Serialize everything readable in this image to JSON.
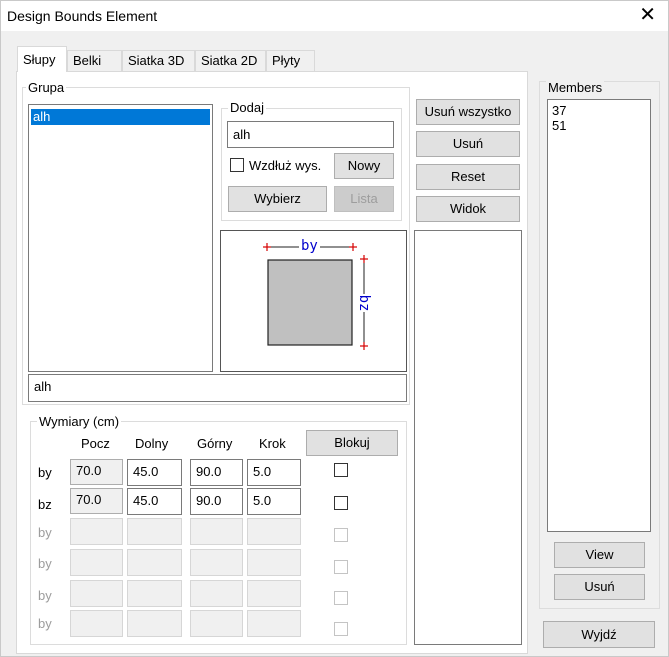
{
  "window": {
    "title": "Design Bounds Element"
  },
  "tabs": [
    {
      "label": "Słupy",
      "active": true
    },
    {
      "label": "Belki"
    },
    {
      "label": "Siatka 3D"
    },
    {
      "label": "Siatka 2D"
    },
    {
      "label": "Płyty"
    }
  ],
  "grupa": {
    "label": "Grupa",
    "items": [
      "alh"
    ],
    "name_value": "alh"
  },
  "dodaj": {
    "label": "Dodaj",
    "input_value": "alh",
    "checkbox_label": "Wzdłuż wys.",
    "checkbox_checked": false,
    "nowy_label": "Nowy",
    "wybierz_label": "Wybierz",
    "lista_label": "Lista"
  },
  "preview": {
    "by_label": "by",
    "bz_label": "bz"
  },
  "actions": {
    "usun_wszystko": "Usuń wszystko",
    "usun": "Usuń",
    "reset": "Reset",
    "widok": "Widok"
  },
  "wymiary": {
    "label": "Wymiary (cm)",
    "headers": [
      "Pocz",
      "Dolny",
      "Górny",
      "Krok"
    ],
    "blokuj_label": "Blokuj",
    "rows": [
      {
        "label": "by",
        "pocz": "70.0",
        "dolny": "45.0",
        "gorny": "90.0",
        "krok": "5.0",
        "enabled": true
      },
      {
        "label": "bz",
        "pocz": "70.0",
        "dolny": "45.0",
        "gorny": "90.0",
        "krok": "5.0",
        "enabled": true
      },
      {
        "label": "by",
        "enabled": false
      },
      {
        "label": "by",
        "enabled": false
      },
      {
        "label": "by",
        "enabled": false
      },
      {
        "label": "by",
        "enabled": false
      }
    ]
  },
  "members": {
    "label": "Members",
    "items": [
      "37",
      "51"
    ],
    "view_label": "View",
    "usun_label": "Usuń"
  },
  "wyjdz_label": "Wyjdź",
  "colors": {
    "selection": "#0078d7",
    "marker": "#d40000",
    "dimension_text": "#0000cc"
  }
}
